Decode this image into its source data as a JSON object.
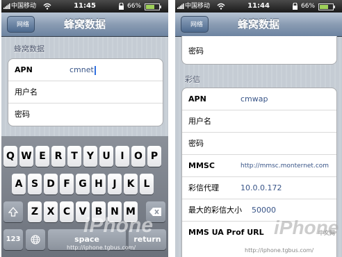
{
  "left": {
    "status": {
      "carrier": "中国移动",
      "time": "11:45",
      "battery": "66%"
    },
    "nav": {
      "back": "网络",
      "title": "蜂窝数据"
    },
    "section_header": "蜂窝数据",
    "rows": [
      {
        "label": "APN",
        "value": "cmnet"
      },
      {
        "label": "用户名",
        "value": ""
      },
      {
        "label": "密码",
        "value": ""
      }
    ],
    "keyboard": {
      "row1": [
        "Q",
        "W",
        "E",
        "R",
        "T",
        "Y",
        "U",
        "I",
        "O",
        "P"
      ],
      "row2": [
        "A",
        "S",
        "D",
        "F",
        "G",
        "H",
        "J",
        "K",
        "L"
      ],
      "row3": [
        "Z",
        "X",
        "C",
        "V",
        "B",
        "N",
        "M"
      ],
      "num": "123",
      "space": "space",
      "return": "return"
    },
    "watermark": {
      "brand": "iPhone",
      "url": "http://iphone.tgbus.com/"
    }
  },
  "right": {
    "status": {
      "carrier": "中国移动",
      "time": "11:44",
      "battery": "66%"
    },
    "nav": {
      "back": "网络",
      "title": "蜂窝数据"
    },
    "top_rows": [
      {
        "label": "密码",
        "value": ""
      }
    ],
    "section_header": "彩信",
    "rows": [
      {
        "label": "APN",
        "value": "cmwap"
      },
      {
        "label": "用户名",
        "value": ""
      },
      {
        "label": "密码",
        "value": ""
      },
      {
        "label": "MMSC",
        "value": "http://mmsc.monternet.com"
      },
      {
        "label": "彩信代理",
        "value": "10.0.0.172"
      },
      {
        "label": "最大的彩信大小",
        "value": "50000"
      },
      {
        "label": "MMS UA Prof URL",
        "value": ""
      }
    ],
    "watermark": {
      "brand": "iPhone",
      "site": "中文网",
      "url": "http://iphone.tgbus.com/"
    }
  },
  "icons": [
    "signal-icon",
    "wifi-icon",
    "lock-icon",
    "battery-icon",
    "shift-icon",
    "backspace-icon",
    "globe-icon"
  ]
}
